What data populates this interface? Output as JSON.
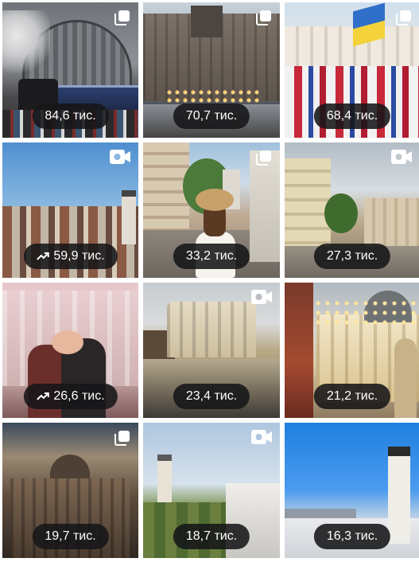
{
  "grid": {
    "items": [
      {
        "views": "84,6 тис.",
        "trending": false,
        "type": "carousel",
        "scene": "train-station",
        "corner_icon": "carousel-icon"
      },
      {
        "views": "70,7 тис.",
        "trending": false,
        "type": "carousel",
        "scene": "market-square-dusk",
        "corner_icon": "carousel-icon"
      },
      {
        "views": "68,4 тис.",
        "trending": false,
        "type": "carousel",
        "scene": "folk-costumes",
        "corner_icon": "carousel-icon"
      },
      {
        "views": "59,9 тис.",
        "trending": true,
        "type": "video",
        "scene": "city-panorama",
        "corner_icon": "video-icon"
      },
      {
        "views": "33,2 тис.",
        "trending": false,
        "type": "carousel",
        "scene": "woman-with-hat",
        "corner_icon": "carousel-icon"
      },
      {
        "views": "27,3 тис.",
        "trending": false,
        "type": "video",
        "scene": "street-view",
        "corner_icon": "video-icon"
      },
      {
        "views": "26,6 тис.",
        "trending": true,
        "type": "photo",
        "scene": "couple-at-opera",
        "corner_icon": ""
      },
      {
        "views": "23,4 тис.",
        "trending": false,
        "type": "video",
        "scene": "opera-reflection",
        "corner_icon": "video-icon"
      },
      {
        "views": "21,2 тис.",
        "trending": false,
        "type": "photo",
        "scene": "christmas-street",
        "corner_icon": ""
      },
      {
        "views": "19,7 тис.",
        "trending": false,
        "type": "carousel",
        "scene": "sunset-rooftops",
        "corner_icon": "carousel-icon"
      },
      {
        "views": "18,7 тис.",
        "trending": false,
        "type": "video",
        "scene": "rooftops-towers",
        "corner_icon": "video-icon"
      },
      {
        "views": "16,3 тис.",
        "trending": false,
        "type": "photo",
        "scene": "city-hall-tower",
        "corner_icon": ""
      }
    ]
  },
  "colors": {
    "pill_background": "#161618",
    "pill_text": "#ffffff",
    "background": "#ffffff"
  }
}
